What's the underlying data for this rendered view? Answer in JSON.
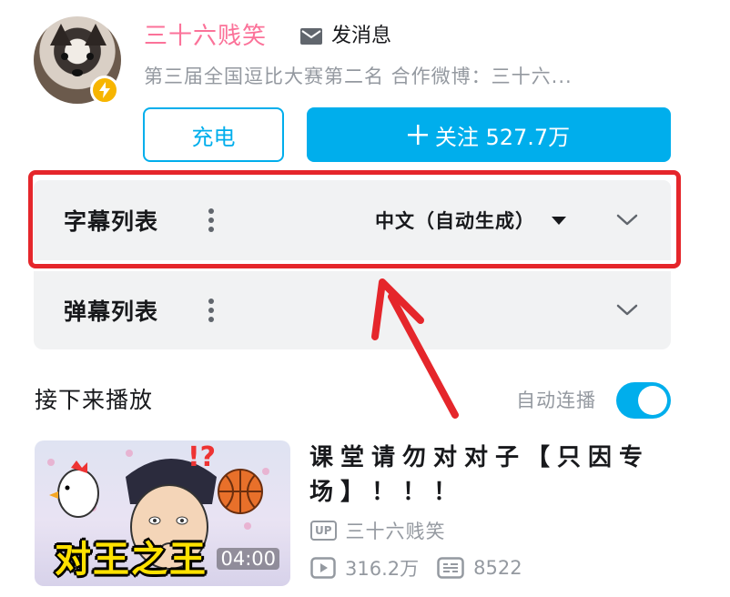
{
  "uploader": {
    "name": "三十六贱笑",
    "message_label": "发消息",
    "bio": "第三届全国逗比大赛第二名 合作微博：三十六...",
    "charge_label": "充电",
    "follow_label": "关注 527.7万"
  },
  "panels": {
    "subtitle_title": "字幕列表",
    "subtitle_language": "中文（自动生成）",
    "danmaku_title": "弹幕列表"
  },
  "next": {
    "title": "接下来播放",
    "autoplay_label": "自动连播",
    "autoplay_on": true
  },
  "video": {
    "title": "课堂请勿对对子【只因专场】！！！",
    "thumb_caption": "对王之王",
    "duration": "04:00",
    "up_badge": "UP",
    "uploader": "三十六贱笑",
    "views": "316.2万",
    "danmaku_count": "8522"
  },
  "colors": {
    "accent": "#00aeec",
    "username_pink": "#fb7299",
    "highlight_red": "#e5262b",
    "badge_gold": "#f7b500"
  },
  "icons": [
    "bolt-icon",
    "mail-icon",
    "plus-icon",
    "more-vertical-icon",
    "caret-down-icon",
    "chevron-down-icon",
    "play-icon",
    "danmaku-icon",
    "up-badge-icon"
  ]
}
